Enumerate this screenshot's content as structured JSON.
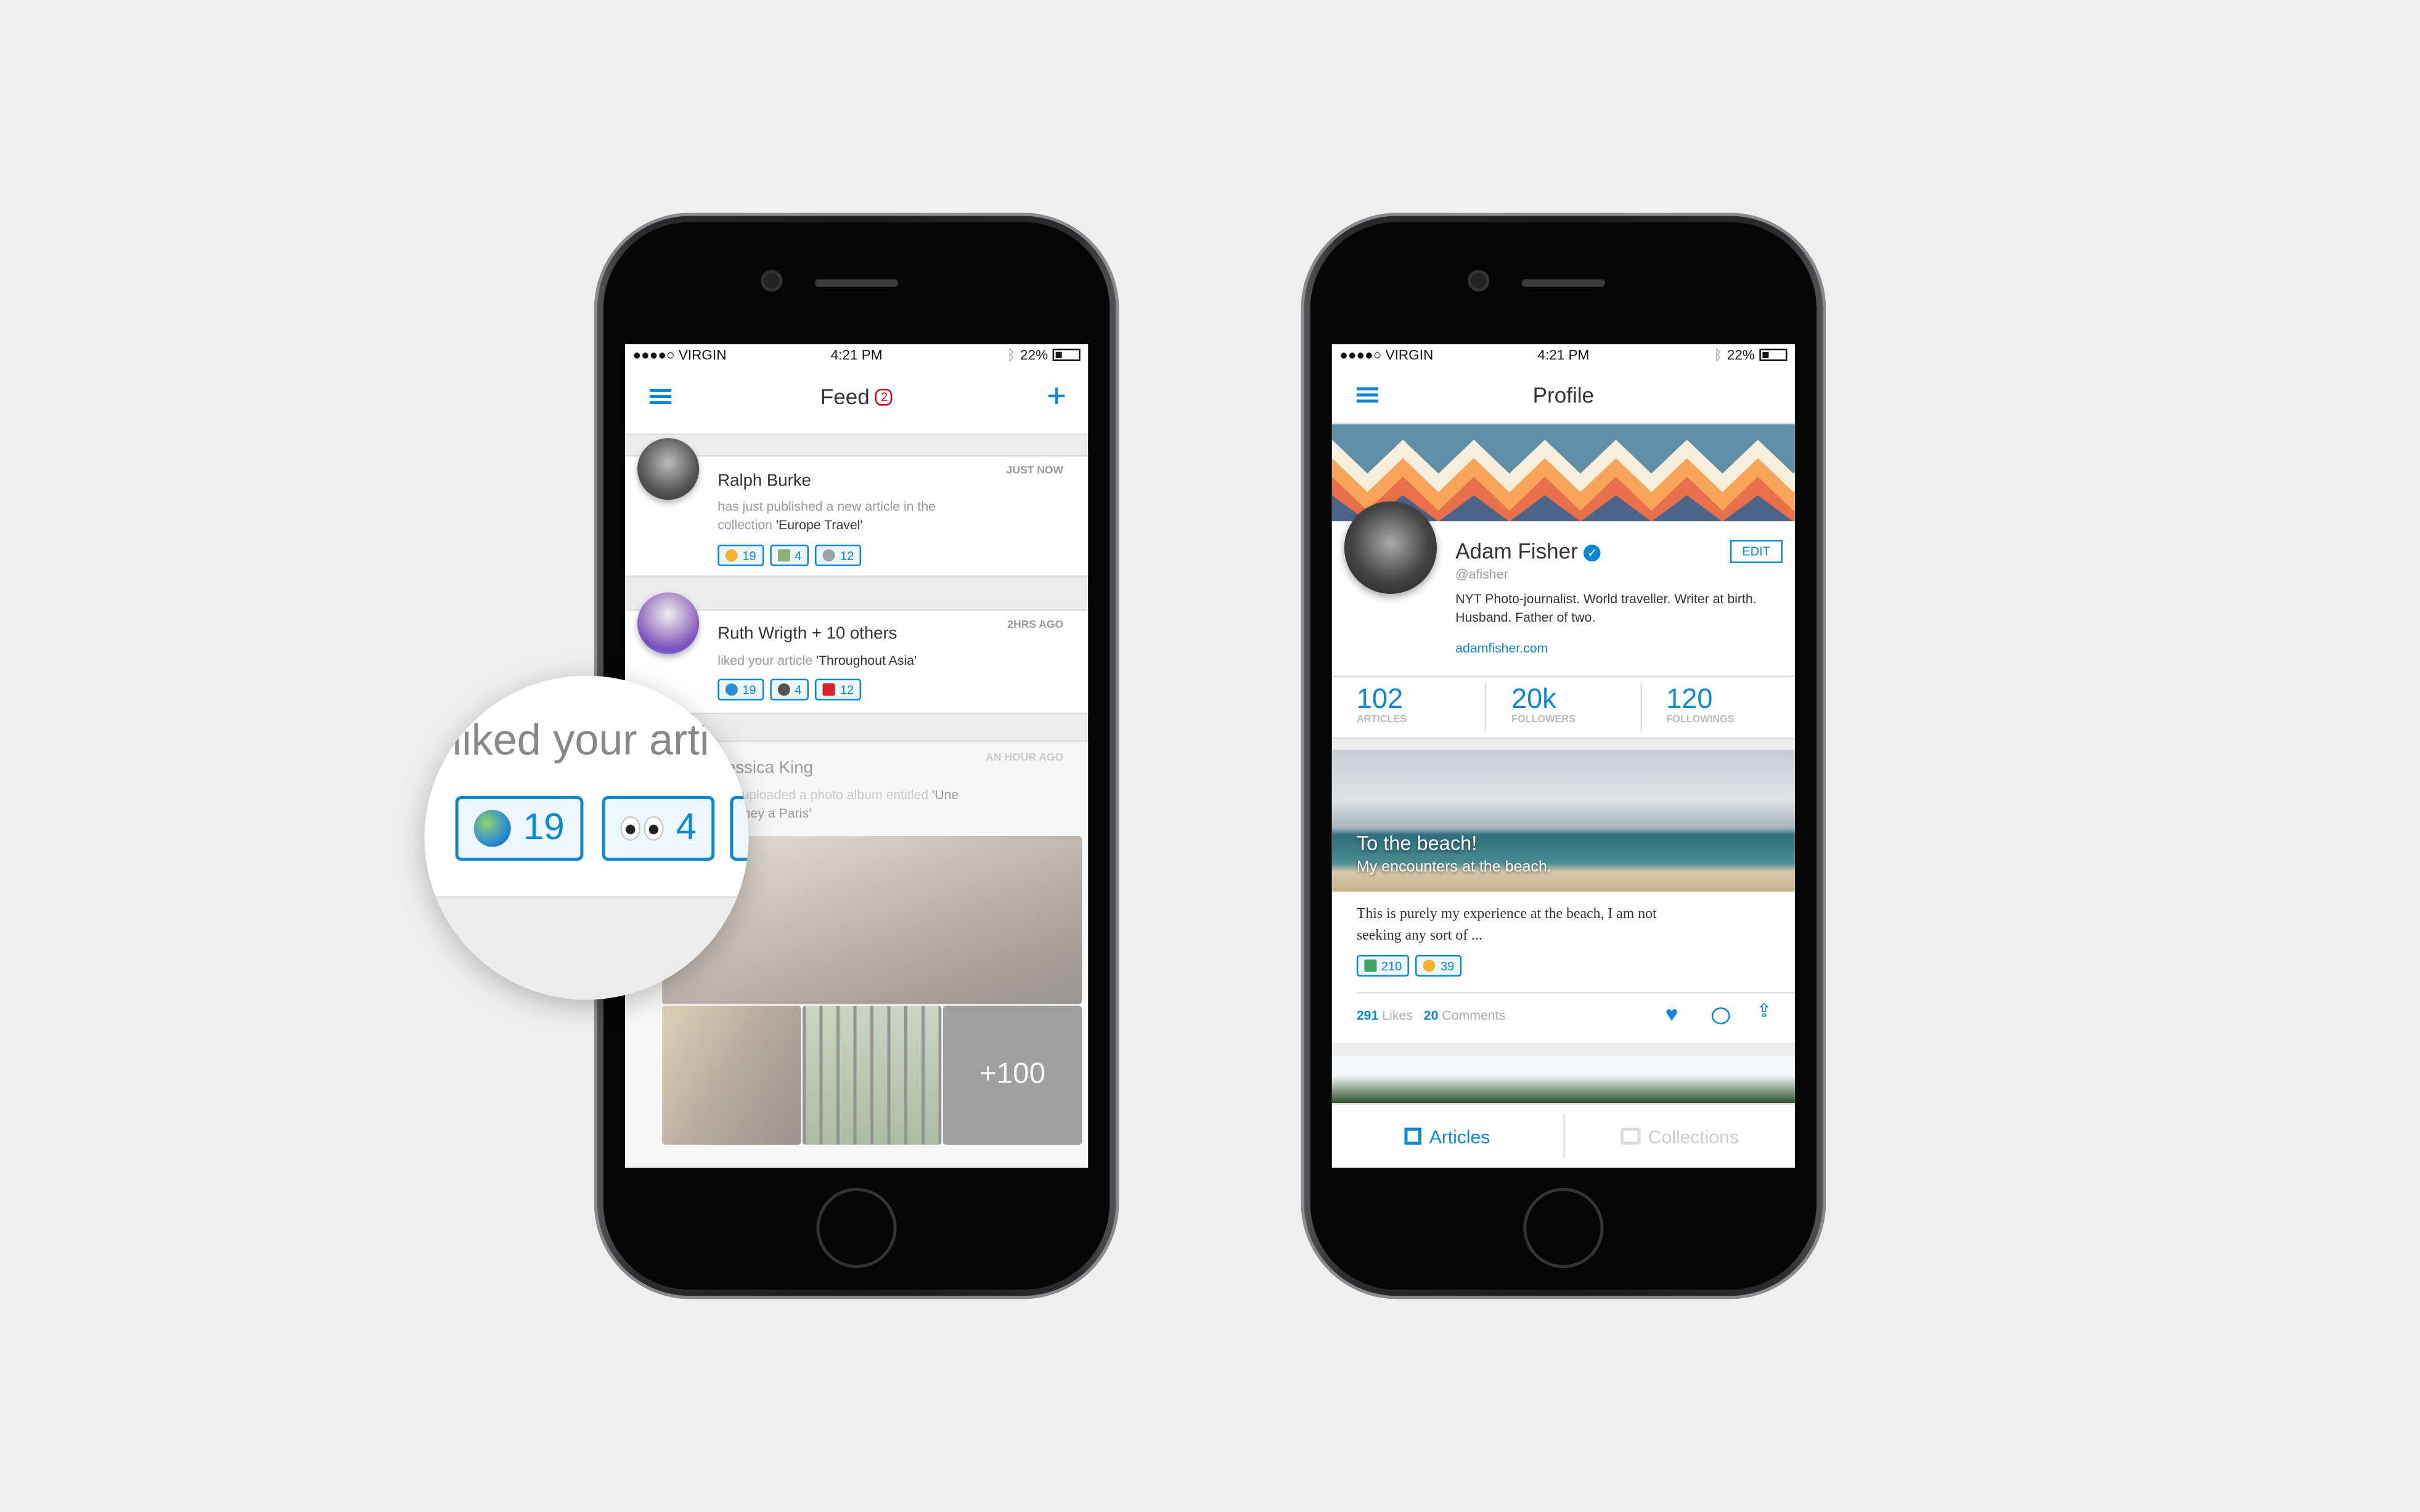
{
  "status_bar": {
    "carrier": "●●●●○ VIRGIN",
    "time": "4:21 PM",
    "battery": "22%",
    "battery_level": 0.22
  },
  "feed": {
    "title": "Feed",
    "notification_count": "2",
    "items": [
      {
        "name": "Ralph Burke",
        "time": "JUST NOW",
        "desc": "has just published a new article in the collection ",
        "highlight": "'Europe Travel'",
        "reactions": [
          {
            "icon": "ok-hand-icon",
            "color": "#f5b331",
            "count": "19"
          },
          {
            "icon": "money-icon",
            "color": "#8bb174",
            "count": "4"
          },
          {
            "icon": "airplane-icon",
            "color": "#9aa4ad",
            "count": "12"
          }
        ]
      },
      {
        "name": "Ruth Wrigth + 10 others",
        "time": "2HRS AGO",
        "desc": "liked your article ",
        "highlight": "'Throughout Asia'",
        "reactions": [
          {
            "icon": "globe-icon",
            "color": "#2c8fd6",
            "count": "19"
          },
          {
            "icon": "eyes-icon",
            "color": "#555555",
            "count": "4"
          },
          {
            "icon": "vietnam-flag-icon",
            "color": "#d8232a",
            "count": "12"
          }
        ]
      },
      {
        "name": "Jessica King",
        "time": "AN HOUR AGO",
        "desc": "just uploaded a photo album entitled ",
        "highlight": "'Une Journey a Paris'",
        "more_photos": "+100"
      }
    ],
    "magnifier": {
      "text": "liked your arti",
      "reactions": [
        {
          "icon": "globe-icon",
          "color": "#2c8fd6",
          "count": "19"
        },
        {
          "icon": "eyes-icon",
          "color": "#555555",
          "count": "4"
        }
      ]
    }
  },
  "profile": {
    "title": "Profile",
    "name": "Adam Fisher",
    "handle": "@afisher",
    "edit_label": "EDIT",
    "bio": "NYT Photo-journalist. World traveller. Writer at birth. Husband. Father of two.",
    "website": "adamfisher.com",
    "stats": [
      {
        "value": "102",
        "label": "ARTICLES"
      },
      {
        "value": "20k",
        "label": "FOLLOWERS"
      },
      {
        "value": "120",
        "label": "FOLLOWINGS"
      }
    ],
    "article": {
      "title": "To the beach!",
      "subtitle": "My encounters at the beach.",
      "excerpt": "This is purely my experience at the beach, I am not seeking any sort of ...",
      "reactions": [
        {
          "icon": "surfer-icon",
          "color": "#3aa66a",
          "count": "210"
        },
        {
          "icon": "thumbs-down-icon",
          "color": "#f5b331",
          "count": "39"
        }
      ],
      "likes": "291",
      "likes_label": "Likes",
      "comments": "20",
      "comments_label": "Comments"
    },
    "tabs": [
      {
        "label": "Articles",
        "active": true
      },
      {
        "label": "Collections",
        "active": false
      }
    ]
  },
  "colors": {
    "accent": "#0a88d8",
    "badge": "#d0021b"
  }
}
